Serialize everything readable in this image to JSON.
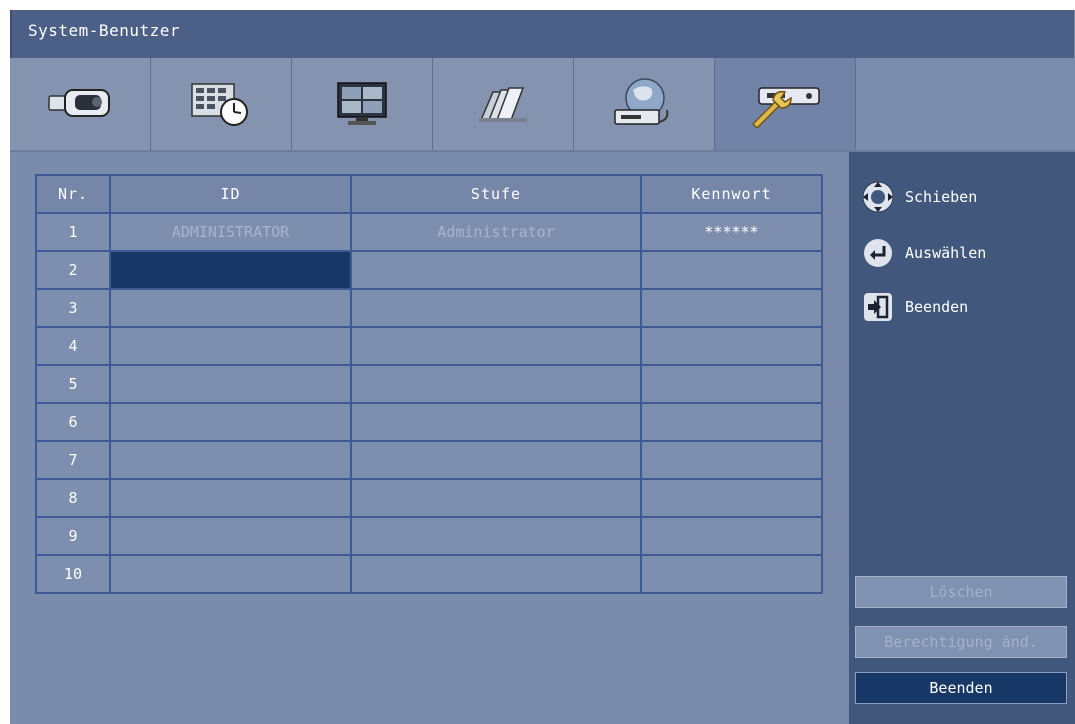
{
  "window": {
    "title": "System-Benutzer"
  },
  "tabs": [
    {
      "icon": "camera-icon"
    },
    {
      "icon": "schedule-icon"
    },
    {
      "icon": "monitor-icon"
    },
    {
      "icon": "archive-icon"
    },
    {
      "icon": "network-icon"
    },
    {
      "icon": "system-tools-icon",
      "active": true
    }
  ],
  "table": {
    "headers": [
      "Nr.",
      "ID",
      "Stufe",
      "Kennwort"
    ],
    "rows": [
      {
        "nr": "1",
        "id": "ADMINISTRATOR",
        "stufe": "Administrator",
        "kennwort": "******"
      },
      {
        "nr": "2",
        "id": "",
        "stufe": "",
        "kennwort": ""
      },
      {
        "nr": "3",
        "id": "",
        "stufe": "",
        "kennwort": ""
      },
      {
        "nr": "4",
        "id": "",
        "stufe": "",
        "kennwort": ""
      },
      {
        "nr": "5",
        "id": "",
        "stufe": "",
        "kennwort": ""
      },
      {
        "nr": "6",
        "id": "",
        "stufe": "",
        "kennwort": ""
      },
      {
        "nr": "7",
        "id": "",
        "stufe": "",
        "kennwort": ""
      },
      {
        "nr": "8",
        "id": "",
        "stufe": "",
        "kennwort": ""
      },
      {
        "nr": "9",
        "id": "",
        "stufe": "",
        "kennwort": ""
      },
      {
        "nr": "10",
        "id": "",
        "stufe": "",
        "kennwort": ""
      }
    ]
  },
  "legend": {
    "move": "Schieben",
    "select": "Auswählen",
    "exit": "Beenden"
  },
  "buttons": {
    "delete": "Löschen",
    "change_permission": "Berechtigung änd.",
    "exit": "Beenden"
  },
  "colors": {
    "title_bar": "#4c5f87",
    "panel": "#7a8bab",
    "side_panel": "#41587c",
    "selection": "#173866",
    "grid": "#3d5a94"
  }
}
